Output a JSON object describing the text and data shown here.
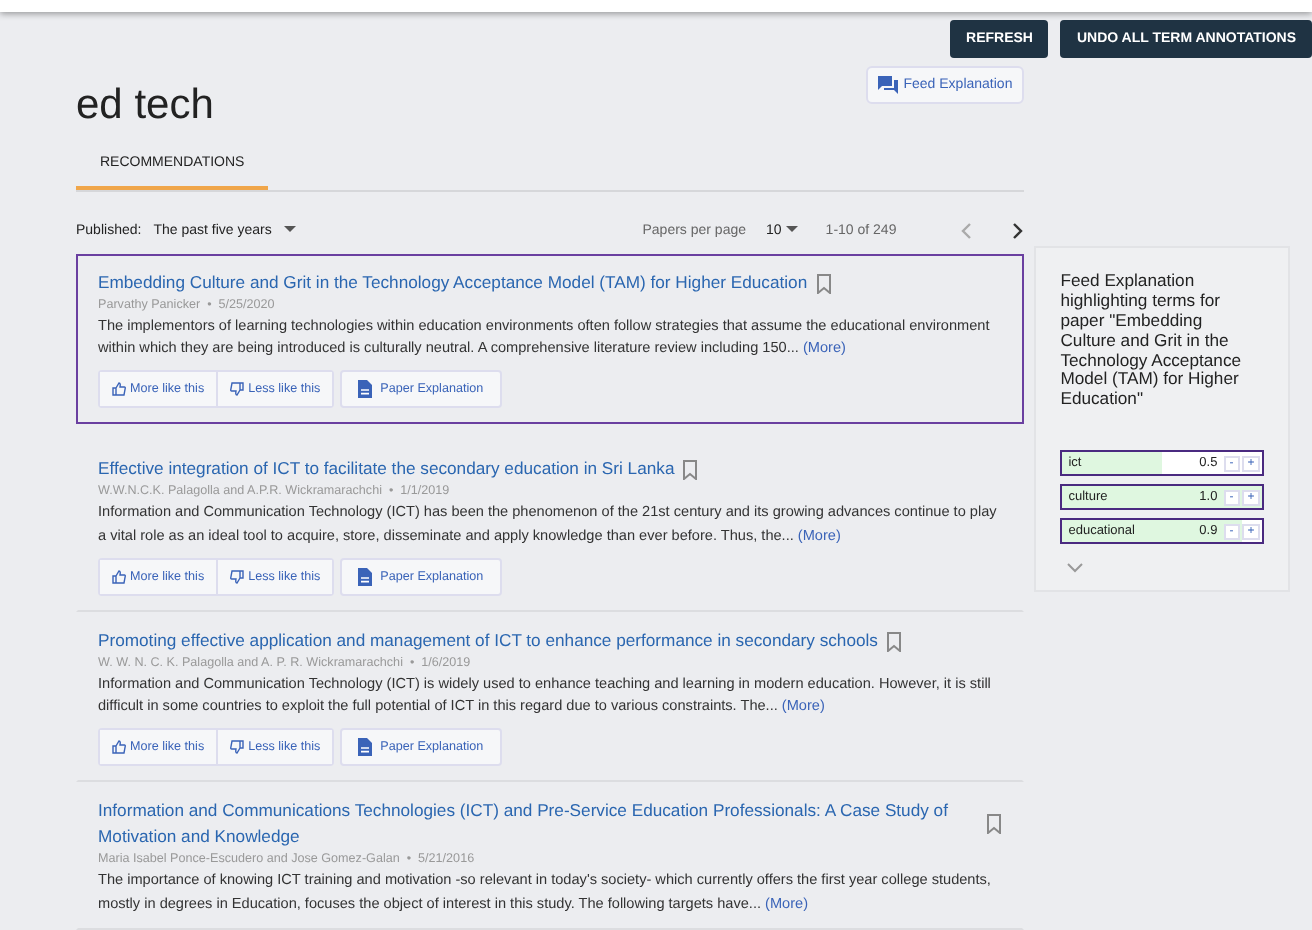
{
  "header": {
    "refresh": "REFRESH",
    "undo": "UNDO ALL TERM ANNOTATIONS",
    "title": "ed tech",
    "feed_explanation": "Feed Explanation"
  },
  "tabs": [
    {
      "label": "RECOMMENDATIONS",
      "selected": true
    }
  ],
  "filters": {
    "published_label": "Published:",
    "published_value": "The past five years",
    "per_page_label": "Papers per page",
    "per_page_value": "10",
    "range": "1-10 of 249"
  },
  "meta_separator": "•",
  "papers": [
    {
      "title": "Embedding Culture and Grit in the Technology Acceptance Model (TAM) for Higher Education",
      "authors": "Parvathy Panicker",
      "date": "5/25/2020",
      "abstract": "The implementors of learning technologies within education environments often follow strategies that assume the educational environment within which they are being introduced is culturally neutral. A comprehensive literature review including 150...",
      "more": "(More)",
      "selected": true,
      "actions": [
        "More like this",
        "Less like this",
        "Paper Explanation"
      ]
    },
    {
      "title": "Effective integration of ICT to facilitate the secondary education in Sri Lanka",
      "authors": "W.W.N.C.K. Palagolla and A.P.R. Wickramarachchi",
      "date": "1/1/2019",
      "abstract": "Information and Communication Technology (ICT) has been the phenomenon of the 21st century and its growing advances continue to play a vital role as an ideal tool to acquire, store, disseminate and apply knowledge than ever before. Thus, the...",
      "more": "(More)",
      "selected": false,
      "actions": [
        "More like this",
        "Less like this",
        "Paper Explanation"
      ]
    },
    {
      "title": "Promoting effective application and management of ICT to enhance performance in secondary schools",
      "authors": "W. W. N. C. K. Palagolla and A. P. R. Wickramarachchi",
      "date": "1/6/2019",
      "abstract": "Information and Communication Technology (ICT) is widely used to enhance teaching and learning in modern education. However, it is still difficult in some countries to exploit the full potential of ICT in this regard due to various constraints. The...",
      "more": "(More)",
      "selected": false,
      "actions": [
        "More like this",
        "Less like this",
        "Paper Explanation"
      ]
    },
    {
      "title": "Information and Communications Technologies (ICT) and Pre-Service Education Professionals: A Case Study of Motivation and Knowledge",
      "authors": "Maria Isabel Ponce-Escudero and Jose Gomez-Galan",
      "date": "5/21/2016",
      "abstract": "The importance of knowing ICT training and motivation -so relevant in today's society- which currently offers the first year college students, mostly in degrees in Education, focuses the object of interest in this study. The following targets have...",
      "more": "(More)",
      "selected": false
    }
  ],
  "explanation": {
    "heading": "Feed Explanation highlighting terms for paper \"Embedding Culture and Grit in the Technology Acceptance Model (TAM) for Higher Education\"",
    "terms": [
      {
        "term": "ict",
        "weight": "0.5",
        "level": 0.5,
        "minus": "-",
        "plus": "+"
      },
      {
        "term": "culture",
        "weight": "1.0",
        "level": 1.0,
        "minus": "-",
        "plus": "+"
      },
      {
        "term": "educational",
        "weight": "0.9",
        "level": 0.9,
        "minus": "-",
        "plus": "+"
      }
    ]
  }
}
